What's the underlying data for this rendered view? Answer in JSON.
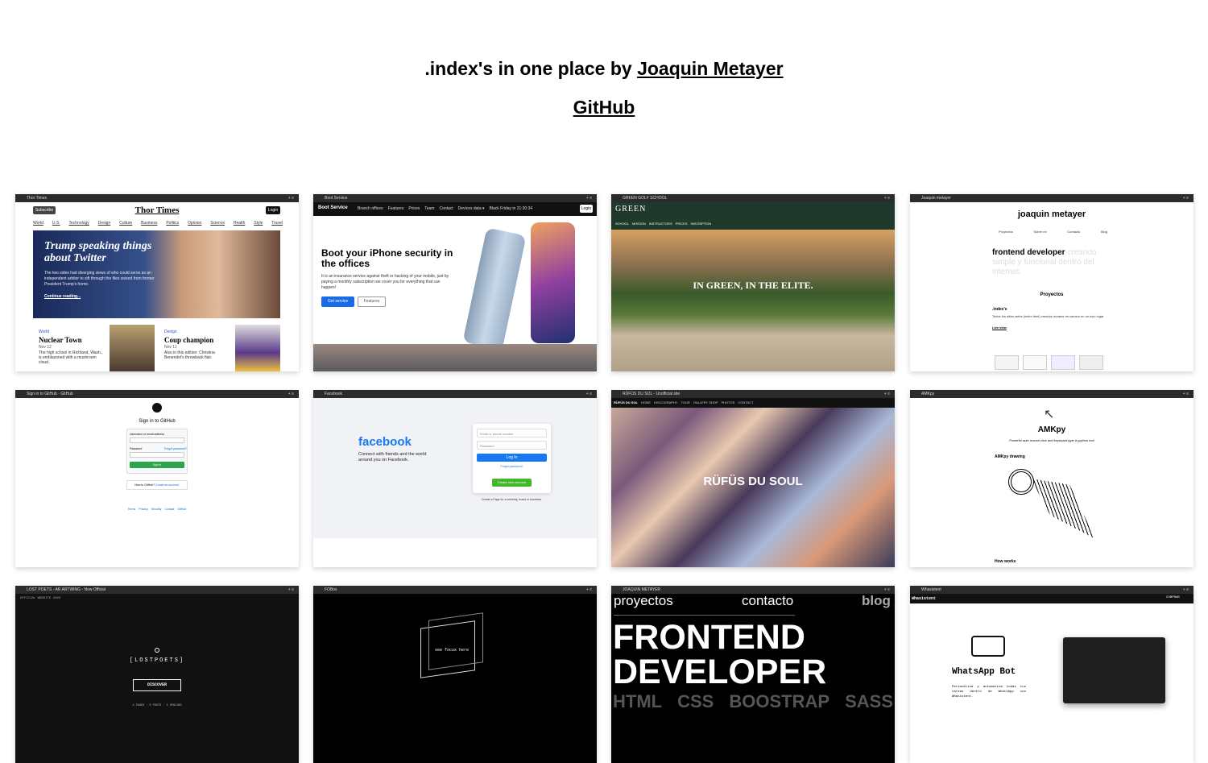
{
  "header": {
    "title_prefix": ".index's in one place by ",
    "author": "Joaquin Metayer",
    "github": "GitHub"
  },
  "cards": {
    "thor": {
      "tab": "Thor Times",
      "logo": "Thor Times",
      "subscribe": "Subscribe",
      "login": "Login",
      "nav": [
        "World",
        "U.S.",
        "Technology",
        "Design",
        "Culture",
        "Business",
        "Politics",
        "Opinion",
        "Science",
        "Health",
        "Style",
        "Travel"
      ],
      "headline": "Trump speaking things about Twitter",
      "blurb": "The two sides had diverging views of who could serve as an independent arbiter to sift through the files seized from former President Trump's home.",
      "continue": "Continue reading...",
      "a1_tag": "World",
      "a1_title": "Nuclear Town",
      "a1_date": "Nov 12",
      "a1_text": "The high school in Richland, Wash., is emblazoned with a mushroom cloud.",
      "a2_tag": "Design",
      "a2_title": "Coup champion",
      "a2_date": "Nov 11",
      "a2_text": "Also in this edition: Christina Benendel's throwback flair."
    },
    "boot": {
      "tab": "Boot Service",
      "brand": "Boot Service",
      "nav": [
        "Branch offices",
        "Features",
        "Prices",
        "Team",
        "Contact",
        "Devices data ▾",
        "Black Friday in 21:30:34"
      ],
      "login": "Login",
      "headline": "Boot your iPhone security in the offices",
      "text": "It is an insurance service against theft or hacking of your mobile, just by paying a monthly subscription we cover you for everything that can happen!",
      "btn1": "Get service",
      "btn2": "Features"
    },
    "green": {
      "tab": "GREEN GOLF SCHOOL",
      "logo": "GREEN",
      "nav": [
        "SCHOOL",
        "MISSION",
        "INSTRUCTORS",
        "PRICES",
        "INSCRIPTION"
      ],
      "headline": "IN GREEN, IN THE ELITE."
    },
    "jm": {
      "tab": "Joaquin metayer",
      "name": "joaquin metayer",
      "nav": [
        "Proyectos",
        "Sobre mi",
        "Contacto",
        "Blog"
      ],
      "role": "frontend developer",
      "role_faint": "creando simple y funcional dentro del internet.",
      "proyectos": "Proyectos",
      "item": ".index's",
      "item_text": "Todos los sitios webs (index.html) creados durante mi camino en un solo lugar",
      "live": "Live view"
    },
    "github": {
      "tab": "Sign in to GitHub · GitHub",
      "heading": "Sign in to GitHub",
      "user_label": "Username or email address",
      "pass_label": "Password",
      "forgot": "Forgot password?",
      "signin": "Sign in",
      "new": "New to GitHub?",
      "create": "Create an account.",
      "footer": [
        "Terms",
        "Privacy",
        "Security",
        "Contact GitHub"
      ]
    },
    "facebook": {
      "tab": "Facebook",
      "logo": "facebook",
      "tagline": "Connect with friends and the world around you on Facebook.",
      "email_ph": "Email or phone number",
      "pass_ph": "Password",
      "login": "Log In",
      "forgot": "Forgot password?",
      "create": "Create new account",
      "page": "Create a Page for a celebrity, brand or business."
    },
    "rufus": {
      "tab": "RÜFÜS DU SOL - Unofficial site",
      "nav": [
        "RÜFÜS DU SOL",
        "HOME",
        "DISCOGRAPHY",
        "TOUR",
        "GALLERY SHOP",
        "PHOTOS",
        "CONTACT"
      ],
      "headline": "RÜFÜS DU SOUL"
    },
    "amkpy": {
      "tab": "AMKpy",
      "title": "AMKpy",
      "subtitle": "Powerful auto mouse click and keyboard type in python tool",
      "drawing": "AMKpy drawing",
      "how": "How works"
    },
    "lost": {
      "tab": "LOST POETS - AR ARTWING - Now Official",
      "label": "OFFICIAL WEBSITE 2022",
      "logo": "[LOSTPOETS]",
      "discover": "DISCOVER",
      "stats": "4 PAGES · 0 POSTS · 3 SPACING"
    },
    "focus": {
      "tab": "FOBox",
      "text": "see focus here"
    },
    "frontend": {
      "tab": "JOAQUIN METAYER",
      "nav": [
        "proyectos",
        "contacto",
        "blog"
      ],
      "line1": "FRONTEND",
      "line2": "DEVELOPER",
      "skills": [
        "HTML",
        "CSS",
        "BOOSTRAP",
        "SASS"
      ]
    },
    "whats": {
      "tab": "Whasistent",
      "brand": "Whasistent",
      "btn": "COMPRAR",
      "title": "WhatsApp Bot",
      "text": "Personaliza y automatiza todas tus tareas dentro de WhatsApp con Whasistent."
    }
  },
  "colors": {
    "facebook_blue": "#1877f2",
    "github_green": "#2da44e",
    "green_dark": "#1f3a2c"
  }
}
